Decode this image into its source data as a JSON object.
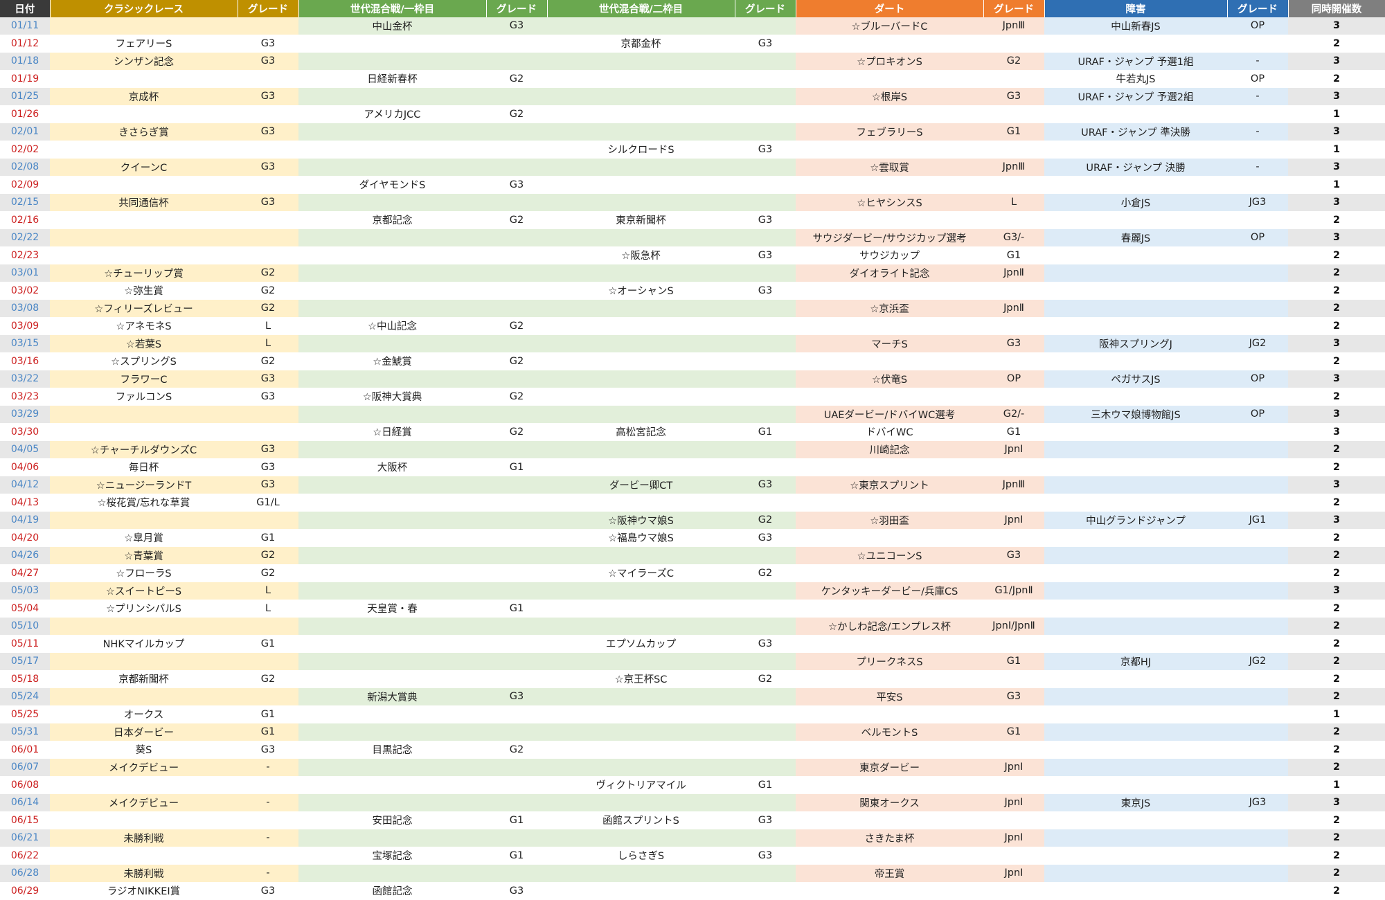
{
  "headers": [
    "日付",
    "クラシックレース",
    "グレード",
    "世代混合戦/一枠目",
    "グレード",
    "世代混合戦/二枠目",
    "グレード",
    "ダート",
    "グレード",
    "障害",
    "グレード",
    "同時開催数"
  ],
  "rows": [
    [
      "01/11",
      "",
      "",
      "中山金杯",
      "G3",
      "",
      "",
      "☆ブルーバードC",
      "JpnⅢ",
      "中山新春JS",
      "OP",
      "3"
    ],
    [
      "01/12",
      "フェアリーS",
      "G3",
      "",
      "",
      "京都金杯",
      "G3",
      "",
      "",
      "",
      "",
      "2"
    ],
    [
      "01/18",
      "シンザン記念",
      "G3",
      "",
      "",
      "",
      "",
      "☆プロキオンS",
      "G2",
      "URAF・ジャンプ 予選1組",
      "-",
      "3"
    ],
    [
      "01/19",
      "",
      "",
      "日経新春杯",
      "G2",
      "",
      "",
      "",
      "",
      "牛若丸JS",
      "OP",
      "2"
    ],
    [
      "01/25",
      "京成杯",
      "G3",
      "",
      "",
      "",
      "",
      "☆根岸S",
      "G3",
      "URAF・ジャンプ 予選2組",
      "-",
      "3"
    ],
    [
      "01/26",
      "",
      "",
      "アメリカJCC",
      "G2",
      "",
      "",
      "",
      "",
      "",
      "",
      "1"
    ],
    [
      "02/01",
      "きさらぎ賞",
      "G3",
      "",
      "",
      "",
      "",
      "フェブラリーS",
      "G1",
      "URAF・ジャンプ 準決勝",
      "-",
      "3"
    ],
    [
      "02/02",
      "",
      "",
      "",
      "",
      "シルクロードS",
      "G3",
      "",
      "",
      "",
      "",
      "1"
    ],
    [
      "02/08",
      "クイーンC",
      "G3",
      "",
      "",
      "",
      "",
      "☆雲取賞",
      "JpnⅢ",
      "URAF・ジャンプ 決勝",
      "-",
      "3"
    ],
    [
      "02/09",
      "",
      "",
      "ダイヤモンドS",
      "G3",
      "",
      "",
      "",
      "",
      "",
      "",
      "1"
    ],
    [
      "02/15",
      "共同通信杯",
      "G3",
      "",
      "",
      "",
      "",
      "☆ヒヤシンスS",
      "L",
      "小倉JS",
      "JG3",
      "3"
    ],
    [
      "02/16",
      "",
      "",
      "京都記念",
      "G2",
      "東京新聞杯",
      "G3",
      "",
      "",
      "",
      "",
      "2"
    ],
    [
      "02/22",
      "",
      "",
      "",
      "",
      "",
      "",
      "サウジダービー/サウジカップ選考",
      "G3/-",
      "春麗JS",
      "OP",
      "3"
    ],
    [
      "02/23",
      "",
      "",
      "",
      "",
      "☆阪急杯",
      "G3",
      "サウジカップ",
      "G1",
      "",
      "",
      "2"
    ],
    [
      "03/01",
      "☆チューリップ賞",
      "G2",
      "",
      "",
      "",
      "",
      "ダイオライト記念",
      "JpnⅡ",
      "",
      "",
      "2"
    ],
    [
      "03/02",
      "☆弥生賞",
      "G2",
      "",
      "",
      "☆オーシャンS",
      "G3",
      "",
      "",
      "",
      "",
      "2"
    ],
    [
      "03/08",
      "☆フィリーズレビュー",
      "G2",
      "",
      "",
      "",
      "",
      "☆京浜盃",
      "JpnⅡ",
      "",
      "",
      "2"
    ],
    [
      "03/09",
      "☆アネモネS",
      "L",
      "☆中山記念",
      "G2",
      "",
      "",
      "",
      "",
      "",
      "",
      "2"
    ],
    [
      "03/15",
      "☆若葉S",
      "L",
      "",
      "",
      "",
      "",
      "マーチS",
      "G3",
      "阪神スプリングJ",
      "JG2",
      "3"
    ],
    [
      "03/16",
      "☆スプリングS",
      "G2",
      "☆金鯱賞",
      "G2",
      "",
      "",
      "",
      "",
      "",
      "",
      "2"
    ],
    [
      "03/22",
      "フラワーC",
      "G3",
      "",
      "",
      "",
      "",
      "☆伏竜S",
      "OP",
      "ペガサスJS",
      "OP",
      "3"
    ],
    [
      "03/23",
      "ファルコンS",
      "G3",
      "☆阪神大賞典",
      "G2",
      "",
      "",
      "",
      "",
      "",
      "",
      "2"
    ],
    [
      "03/29",
      "",
      "",
      "",
      "",
      "",
      "",
      "UAEダービー/ドバイWC選考",
      "G2/-",
      "三木ウマ娘博物館JS",
      "OP",
      "3"
    ],
    [
      "03/30",
      "",
      "",
      "☆日経賞",
      "G2",
      "高松宮記念",
      "G1",
      "ドバイWC",
      "G1",
      "",
      "",
      "3"
    ],
    [
      "04/05",
      "☆チャーチルダウンズC",
      "G3",
      "",
      "",
      "",
      "",
      "川崎記念",
      "JpnⅠ",
      "",
      "",
      "2"
    ],
    [
      "04/06",
      "毎日杯",
      "G3",
      "大阪杯",
      "G1",
      "",
      "",
      "",
      "",
      "",
      "",
      "2"
    ],
    [
      "04/12",
      "☆ニュージーランドT",
      "G3",
      "",
      "",
      "ダービー卿CT",
      "G3",
      "☆東京スプリント",
      "JpnⅢ",
      "",
      "",
      "3"
    ],
    [
      "04/13",
      "☆桜花賞/忘れな草賞",
      "G1/L",
      "",
      "",
      "",
      "",
      "",
      "",
      "",
      "",
      "2"
    ],
    [
      "04/19",
      "",
      "",
      "",
      "",
      "☆阪神ウマ娘S",
      "G2",
      "☆羽田盃",
      "JpnⅠ",
      "中山グランドジャンプ",
      "JG1",
      "3"
    ],
    [
      "04/20",
      "☆皐月賞",
      "G1",
      "",
      "",
      "☆福島ウマ娘S",
      "G3",
      "",
      "",
      "",
      "",
      "2"
    ],
    [
      "04/26",
      "☆青葉賞",
      "G2",
      "",
      "",
      "",
      "",
      "☆ユニコーンS",
      "G3",
      "",
      "",
      "2"
    ],
    [
      "04/27",
      "☆フローラS",
      "G2",
      "",
      "",
      "☆マイラーズC",
      "G2",
      "",
      "",
      "",
      "",
      "2"
    ],
    [
      "05/03",
      "☆スイートピーS",
      "L",
      "",
      "",
      "",
      "",
      "ケンタッキーダービー/兵庫CS",
      "G1/JpnⅡ",
      "",
      "",
      "3"
    ],
    [
      "05/04",
      "☆プリンシパルS",
      "L",
      "天皇賞・春",
      "G1",
      "",
      "",
      "",
      "",
      "",
      "",
      "2"
    ],
    [
      "05/10",
      "",
      "",
      "",
      "",
      "",
      "",
      "☆かしわ記念/エンプレス杯",
      "JpnⅠ/JpnⅡ",
      "",
      "",
      "2"
    ],
    [
      "05/11",
      "NHKマイルカップ",
      "G1",
      "",
      "",
      "エプソムカップ",
      "G3",
      "",
      "",
      "",
      "",
      "2"
    ],
    [
      "05/17",
      "",
      "",
      "",
      "",
      "",
      "",
      "プリークネスS",
      "G1",
      "京都HJ",
      "JG2",
      "2"
    ],
    [
      "05/18",
      "京都新聞杯",
      "G2",
      "",
      "",
      "☆京王杯SC",
      "G2",
      "",
      "",
      "",
      "",
      "2"
    ],
    [
      "05/24",
      "",
      "",
      "新潟大賞典",
      "G3",
      "",
      "",
      "平安S",
      "G3",
      "",
      "",
      "2"
    ],
    [
      "05/25",
      "オークス",
      "G1",
      "",
      "",
      "",
      "",
      "",
      "",
      "",
      "",
      "1"
    ],
    [
      "05/31",
      "日本ダービー",
      "G1",
      "",
      "",
      "",
      "",
      "ベルモントS",
      "G1",
      "",
      "",
      "2"
    ],
    [
      "06/01",
      "葵S",
      "G3",
      "目黒記念",
      "G2",
      "",
      "",
      "",
      "",
      "",
      "",
      "2"
    ],
    [
      "06/07",
      "メイクデビュー",
      "-",
      "",
      "",
      "",
      "",
      "東京ダービー",
      "JpnⅠ",
      "",
      "",
      "2"
    ],
    [
      "06/08",
      "",
      "",
      "",
      "",
      "ヴィクトリアマイル",
      "G1",
      "",
      "",
      "",
      "",
      "1"
    ],
    [
      "06/14",
      "メイクデビュー",
      "-",
      "",
      "",
      "",
      "",
      "関東オークス",
      "JpnⅠ",
      "東京JS",
      "JG3",
      "3"
    ],
    [
      "06/15",
      "",
      "",
      "安田記念",
      "G1",
      "函館スプリントS",
      "G3",
      "",
      "",
      "",
      "",
      "2"
    ],
    [
      "06/21",
      "未勝利戦",
      "-",
      "",
      "",
      "",
      "",
      "さきたま杯",
      "JpnⅠ",
      "",
      "",
      "2"
    ],
    [
      "06/22",
      "",
      "",
      "宝塚記念",
      "G1",
      "しらさぎS",
      "G3",
      "",
      "",
      "",
      "",
      "2"
    ],
    [
      "06/28",
      "未勝利戦",
      "-",
      "",
      "",
      "",
      "",
      "帝王賞",
      "JpnⅠ",
      "",
      "",
      "2"
    ],
    [
      "06/29",
      "ラジオNIKKEI賞",
      "G3",
      "函館記念",
      "G3",
      "",
      "",
      "",
      "",
      "",
      "",
      "2"
    ]
  ],
  "colors": {
    "date_header": "#3a3a3a",
    "classic_header": "#bf9000",
    "mix_header": "#6aa84f",
    "dirt_header": "#ef7d2e",
    "jump_header": "#2f6fb3",
    "count_header": "#7f7f7f"
  }
}
